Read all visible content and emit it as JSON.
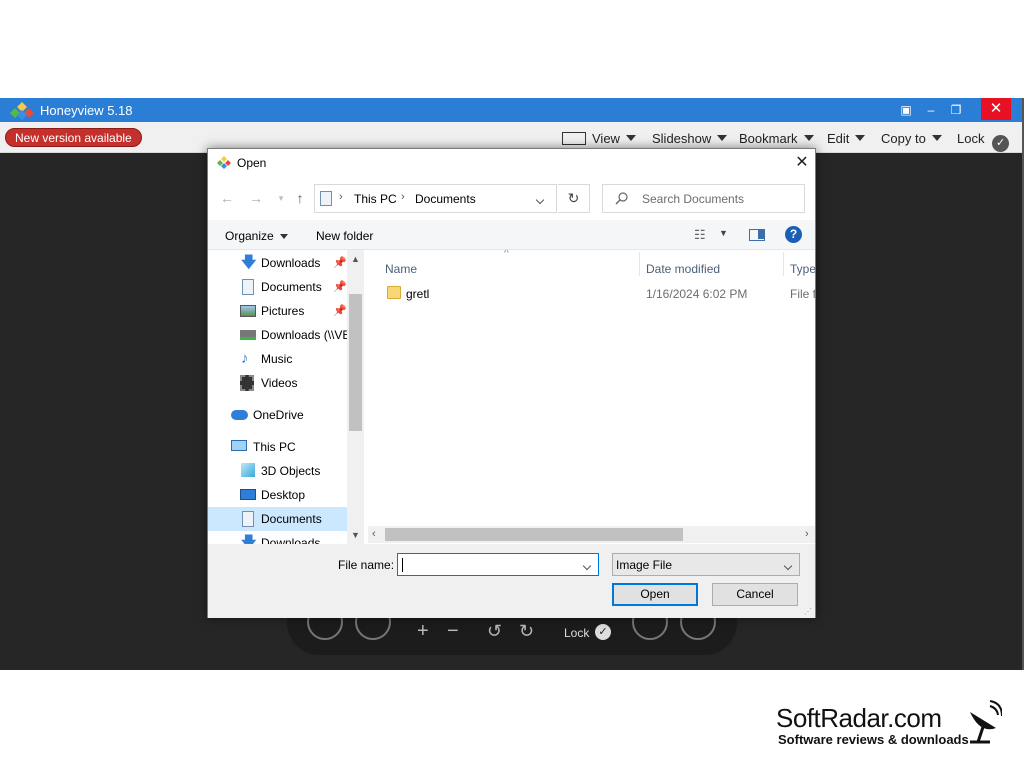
{
  "app": {
    "title": "Honeyview 5.18",
    "new_version": "New version available",
    "toolbar": [
      {
        "label": "View",
        "icon": "fullscreen-icon"
      },
      {
        "label": "Slideshow"
      },
      {
        "label": "Bookmark"
      },
      {
        "label": "Edit"
      },
      {
        "label": "Copy to"
      },
      {
        "label": "Lock",
        "icon": "check-circle-icon"
      }
    ],
    "controlbar": {
      "lock_label": "Lock"
    }
  },
  "dialog": {
    "title": "Open",
    "address": {
      "parts": [
        "This PC",
        "Documents"
      ]
    },
    "search_placeholder": "Search Documents",
    "organize": "Organize",
    "new_folder": "New folder",
    "nav": [
      {
        "label": "Downloads",
        "icon": "download-arrow-icon",
        "pinned": true
      },
      {
        "label": "Documents",
        "icon": "document-icon",
        "pinned": true
      },
      {
        "label": "Pictures",
        "icon": "pictures-icon",
        "pinned": true
      },
      {
        "label": "Downloads (\\\\VE",
        "icon": "network-drive-icon",
        "pinned": false
      },
      {
        "label": "Music",
        "icon": "music-note-icon",
        "pinned": false
      },
      {
        "label": "Videos",
        "icon": "video-icon",
        "pinned": false
      },
      {
        "label": "OneDrive",
        "icon": "cloud-icon",
        "pinned": false
      },
      {
        "label": "This PC",
        "icon": "computer-icon",
        "pinned": false
      },
      {
        "label": "3D Objects",
        "icon": "cube-icon",
        "pinned": false
      },
      {
        "label": "Desktop",
        "icon": "desktop-icon",
        "pinned": false
      },
      {
        "label": "Documents",
        "icon": "document-icon",
        "pinned": false
      },
      {
        "label": "Downloads",
        "icon": "download-arrow-icon",
        "pinned": false
      }
    ],
    "columns": {
      "name": "Name",
      "date": "Date modified",
      "type": "Type"
    },
    "files": [
      {
        "name": "gretl",
        "date": "1/16/2024 6:02 PM",
        "type": "File fo"
      }
    ],
    "file_name_label": "File name:",
    "file_name_value": "",
    "file_type": "Image File",
    "open": "Open",
    "cancel": "Cancel"
  },
  "watermark": {
    "brand": "SoftRadar.com",
    "tagline": "Software reviews & downloads"
  },
  "colors": {
    "titlebar": "#2b7ed6",
    "close": "#e81123",
    "accent": "#0078d7",
    "badge": "#c4302b"
  }
}
